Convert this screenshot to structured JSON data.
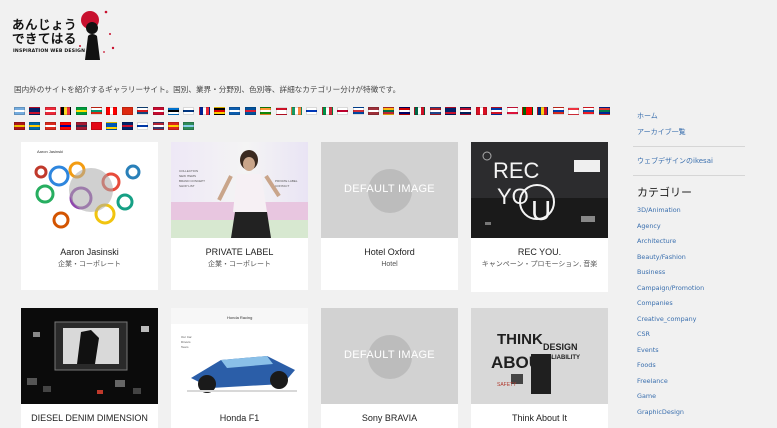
{
  "logo": {
    "line1": "あんじょう",
    "line2": "できてはる",
    "sub": "INSPIRATION WEB DESIGN"
  },
  "tagline": "国内外のサイトを紹介するギャラリーサイト。国別、業界・分野別、色別等、詳細なカテゴリー分けが特徴です。",
  "flags": {
    "row1": [
      {
        "name": "argentina",
        "c": [
          "#74acdf",
          "#ffffff",
          "#74acdf"
        ]
      },
      {
        "name": "australia",
        "c": [
          "#012169",
          "#012169",
          "#c8102e"
        ]
      },
      {
        "name": "austria",
        "c": [
          "#ed2939",
          "#ffffff",
          "#ed2939"
        ]
      },
      {
        "name": "belgium",
        "c": [
          "#000000",
          "#fdda24",
          "#ef3340"
        ],
        "v": true
      },
      {
        "name": "brazil",
        "c": [
          "#009c3b",
          "#ffdf00",
          "#009c3b"
        ]
      },
      {
        "name": "bulgaria",
        "c": [
          "#ffffff",
          "#00966e",
          "#d62612"
        ]
      },
      {
        "name": "canada",
        "c": [
          "#ff0000",
          "#ffffff",
          "#ff0000"
        ],
        "v": true
      },
      {
        "name": "china",
        "c": [
          "#de2910",
          "#de2910",
          "#de2910"
        ]
      },
      {
        "name": "czech",
        "c": [
          "#ffffff",
          "#d7141a",
          "#11457e"
        ]
      },
      {
        "name": "denmark",
        "c": [
          "#c60c30",
          "#ffffff",
          "#c60c30"
        ]
      },
      {
        "name": "estonia",
        "c": [
          "#0072ce",
          "#000000",
          "#ffffff"
        ]
      },
      {
        "name": "finland",
        "c": [
          "#ffffff",
          "#003580",
          "#ffffff"
        ]
      },
      {
        "name": "france",
        "c": [
          "#002395",
          "#ffffff",
          "#ed2939"
        ],
        "v": true
      },
      {
        "name": "germany",
        "c": [
          "#000000",
          "#dd0000",
          "#ffce00"
        ]
      },
      {
        "name": "greece",
        "c": [
          "#0d5eaf",
          "#ffffff",
          "#0d5eaf"
        ]
      },
      {
        "name": "iceland",
        "c": [
          "#02529c",
          "#dc1e35",
          "#02529c"
        ]
      },
      {
        "name": "india",
        "c": [
          "#ff9933",
          "#ffffff",
          "#138808"
        ]
      },
      {
        "name": "indonesia",
        "c": [
          "#ce1126",
          "#ffffff",
          "#ffffff"
        ]
      },
      {
        "name": "ireland",
        "c": [
          "#169b62",
          "#ffffff",
          "#ff883e"
        ],
        "v": true
      },
      {
        "name": "israel",
        "c": [
          "#ffffff",
          "#0038b8",
          "#ffffff"
        ]
      },
      {
        "name": "italy",
        "c": [
          "#009246",
          "#ffffff",
          "#ce2b37"
        ],
        "v": true
      },
      {
        "name": "japan",
        "c": [
          "#ffffff",
          "#bc002d",
          "#ffffff"
        ]
      },
      {
        "name": "korea",
        "c": [
          "#ffffff",
          "#cd2e3a",
          "#0047a0"
        ]
      },
      {
        "name": "latvia",
        "c": [
          "#9e3039",
          "#ffffff",
          "#9e3039"
        ]
      },
      {
        "name": "lithuania",
        "c": [
          "#fdb913",
          "#006a44",
          "#c1272d"
        ]
      },
      {
        "name": "malaysia",
        "c": [
          "#cc0001",
          "#ffffff",
          "#010066"
        ]
      },
      {
        "name": "mexico",
        "c": [
          "#006847",
          "#ffffff",
          "#ce1126"
        ],
        "v": true
      },
      {
        "name": "netherlands",
        "c": [
          "#ae1c28",
          "#ffffff",
          "#21468b"
        ]
      },
      {
        "name": "new-zealand",
        "c": [
          "#012169",
          "#012169",
          "#c8102e"
        ]
      },
      {
        "name": "norway",
        "c": [
          "#ba0c2f",
          "#ffffff",
          "#00205b"
        ]
      },
      {
        "name": "peru",
        "c": [
          "#d91023",
          "#ffffff",
          "#d91023"
        ],
        "v": true
      },
      {
        "name": "philippines",
        "c": [
          "#0038a8",
          "#ffffff",
          "#ce1126"
        ]
      },
      {
        "name": "poland",
        "c": [
          "#ffffff",
          "#ffffff",
          "#dc143c"
        ]
      },
      {
        "name": "portugal",
        "c": [
          "#006600",
          "#ff0000",
          "#ff0000"
        ],
        "v": true
      },
      {
        "name": "romania",
        "c": [
          "#002b7f",
          "#fcd116",
          "#ce1126"
        ],
        "v": true
      },
      {
        "name": "russia",
        "c": [
          "#ffffff",
          "#0039a6",
          "#d52b1e"
        ]
      },
      {
        "name": "singapore",
        "c": [
          "#ef3340",
          "#ffffff",
          "#ffffff"
        ]
      },
      {
        "name": "slovakia",
        "c": [
          "#ffffff",
          "#0b4ea2",
          "#ee1c25"
        ]
      },
      {
        "name": "south-africa",
        "c": [
          "#de3831",
          "#007a4d",
          "#002395"
        ]
      }
    ],
    "row2": [
      {
        "name": "spain",
        "c": [
          "#aa151b",
          "#f1bf00",
          "#aa151b"
        ]
      },
      {
        "name": "sweden",
        "c": [
          "#006aa7",
          "#fecc00",
          "#006aa7"
        ]
      },
      {
        "name": "switzerland",
        "c": [
          "#da291c",
          "#ffffff",
          "#da291c"
        ]
      },
      {
        "name": "taiwan",
        "c": [
          "#fe0000",
          "#000095",
          "#fe0000"
        ]
      },
      {
        "name": "thailand",
        "c": [
          "#a51931",
          "#2d2a4a",
          "#a51931"
        ]
      },
      {
        "name": "turkey",
        "c": [
          "#e30a17",
          "#e30a17",
          "#e30a17"
        ]
      },
      {
        "name": "ukraine",
        "c": [
          "#0057b7",
          "#0057b7",
          "#ffd700"
        ]
      },
      {
        "name": "uk",
        "c": [
          "#012169",
          "#c8102e",
          "#012169"
        ]
      },
      {
        "name": "uruguay",
        "c": [
          "#ffffff",
          "#0038a8",
          "#ffffff"
        ]
      },
      {
        "name": "usa",
        "c": [
          "#b22234",
          "#ffffff",
          "#3c3b6e"
        ]
      },
      {
        "name": "vietnam",
        "c": [
          "#da251d",
          "#ffcd00",
          "#da251d"
        ]
      },
      {
        "name": "world",
        "c": [
          "#2e8b57",
          "#87ceeb",
          "#2e8b57"
        ]
      }
    ]
  },
  "cards": [
    {
      "title": "Aaron Jasinski",
      "cat": "企業・コーポレート",
      "thumb": "dots"
    },
    {
      "title": "PRIVATE LABEL",
      "cat": "企業・コーポレート",
      "thumb": "fashion"
    },
    {
      "title": "Hotel Oxford",
      "cat": "Hotel",
      "thumb": "default",
      "default_text": "DEFAULT IMAGE"
    },
    {
      "title": "REC YOU.",
      "cat": "キャンペーン・プロモーション, 音楽",
      "thumb": "recyou"
    },
    {
      "title": "DIESEL DENIM DIMENSION",
      "cat": "",
      "thumb": "diesel"
    },
    {
      "title": "Honda F1",
      "cat": "",
      "thumb": "f1"
    },
    {
      "title": "Sony BRAVIA",
      "cat": "",
      "thumb": "default",
      "default_text": "DEFAULT IMAGE"
    },
    {
      "title": "Think About It",
      "cat": "",
      "thumb": "think"
    }
  ],
  "sidebar": {
    "links": [
      "ホーム",
      "アーカイブ一覧"
    ],
    "extra": "ウェブデザインのikesai",
    "heading": "カテゴリー",
    "categories": [
      "3D/Animation",
      "Agency",
      "Architecture",
      "Beauty/Fashion",
      "Business",
      "Campaign/Promotion",
      "Companies",
      "Creative_company",
      "CSR",
      "Events",
      "Foods",
      "Freelance",
      "Game",
      "GraphicDesign"
    ]
  },
  "colors": {
    "link": "#3a6fae",
    "background": "#f1f1f1",
    "logo_red": "#c8102e"
  }
}
